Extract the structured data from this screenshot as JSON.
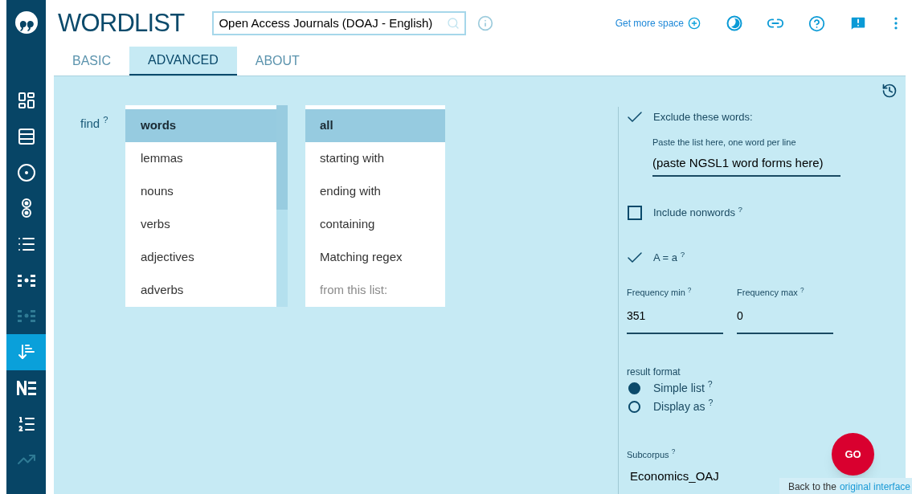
{
  "app_title": "WORDLIST",
  "corpus_field": {
    "value": "Open Access Journals (DOAJ - English)"
  },
  "header_link": "Get more space",
  "sidebar": {
    "items": [
      {
        "kind": "dashboard",
        "selected": false,
        "disabled": false
      },
      {
        "kind": "list",
        "selected": false,
        "disabled": false
      },
      {
        "kind": "concordance",
        "selected": false,
        "disabled": false
      },
      {
        "kind": "parallel",
        "selected": false,
        "disabled": false
      },
      {
        "kind": "bullets",
        "selected": false,
        "disabled": false
      },
      {
        "kind": "collocations",
        "selected": false,
        "disabled": false
      },
      {
        "kind": "collocations",
        "selected": false,
        "disabled": true
      },
      {
        "kind": "wordlist",
        "selected": true,
        "disabled": false
      },
      {
        "kind": "ngrams",
        "selected": false,
        "disabled": false
      },
      {
        "kind": "keywords",
        "selected": false,
        "disabled": false
      },
      {
        "kind": "trends",
        "selected": false,
        "disabled": true
      }
    ]
  },
  "tabs": [
    {
      "label": "BASIC",
      "selected": false
    },
    {
      "label": "ADVANCED",
      "selected": true
    },
    {
      "label": "ABOUT",
      "selected": false
    }
  ],
  "find": {
    "label": "find $^{?}$",
    "types": [
      {
        "label": "words",
        "selected": true
      },
      {
        "label": "lemmas",
        "selected": false
      },
      {
        "label": "nouns",
        "selected": false
      },
      {
        "label": "verbs",
        "selected": false
      },
      {
        "label": "adjectives",
        "selected": false
      },
      {
        "label": "adverbs",
        "selected": false
      }
    ],
    "matches": [
      {
        "label": "all",
        "selected": true,
        "disabled": false
      },
      {
        "label": "starting with",
        "selected": false,
        "disabled": false
      },
      {
        "label": "ending with",
        "selected": false,
        "disabled": false
      },
      {
        "label": "containing",
        "selected": false,
        "disabled": false
      },
      {
        "label": "Matching regex",
        "selected": false,
        "disabled": false
      },
      {
        "label": "from this list:",
        "selected": false,
        "disabled": true
      }
    ]
  },
  "exclude": {
    "label": "Exclude these words:",
    "checked": true,
    "hint": "Paste the list here, one word per line",
    "value": "(paste NGSL1 word forms here)"
  },
  "include_nonwords": {
    "label": "Include nonwords $^{?}$",
    "checked": false
  },
  "case_insensitive": {
    "label": "A = a $^{?}$",
    "checked": true
  },
  "frequency": [
    {
      "label": "Frequency min $^{?}$",
      "value": "351"
    },
    {
      "label": "Frequency max $^{?}$",
      "value": "0"
    }
  ],
  "result_format": {
    "label": "result format",
    "options": [
      {
        "label": "Simple list $^{?}$",
        "selected": true
      },
      {
        "label": "Display as $^{?}$",
        "selected": false
      }
    ]
  },
  "subcorpus": {
    "label": "Subcorpus $^{?}$",
    "value": "Economics_OAJ"
  },
  "go_button": "GO",
  "footer": {
    "text": "Back to the",
    "link": "original interface"
  }
}
